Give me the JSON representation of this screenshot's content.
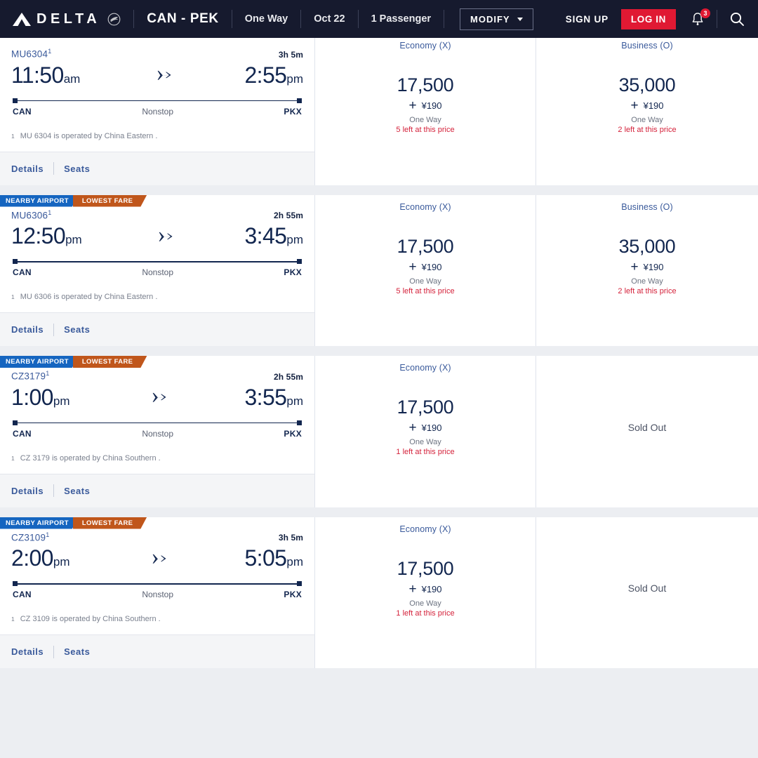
{
  "header": {
    "brand_name": "DELTA",
    "brand_logo_icon": "delta-triangle-icon",
    "skymiles_icon": "skyteam-emblem-icon",
    "route": "CAN - PEK",
    "trip_type": "One Way",
    "date": "Oct 22",
    "passengers": "1 Passenger",
    "modify_label": "MODIFY",
    "sign_up_label": "SIGN UP",
    "log_in_label": "LOG IN",
    "notifications_icon": "bell-icon",
    "notifications_count": "3",
    "search_icon": "search-icon",
    "accent_red": "#e01933",
    "bar_background": "#161a2e"
  },
  "labels": {
    "details": "Details",
    "seats": "Seats",
    "nonstop": "Nonstop",
    "one_way": "One Way",
    "sold_out": "Sold Out",
    "badge_nearby": "NEARBY AIRPORT",
    "badge_lowest": "LOWEST FARE",
    "plus": "+",
    "footnote_marker": "1",
    "plane_icon": "airplane-icon",
    "badge_nearby_color": "#1565c0",
    "badge_lowest_color": "#c0561b"
  },
  "flights": [
    {
      "flight_number": "MU6304",
      "duration": "3h 5m",
      "depart_time": "11:50",
      "depart_meridiem": "am",
      "arrive_time": "2:55",
      "arrive_meridiem": "pm",
      "origin": "CAN",
      "destination": "PKX",
      "stops": "Nonstop",
      "operated_by": "MU 6304 is operated by China Eastern .",
      "has_badges": false,
      "fares": [
        {
          "cabin": "Economy (X)",
          "miles": "17,500",
          "cash": "¥190",
          "one_way": "One Way",
          "seats_left": "5 left at this price",
          "sold_out": false
        },
        {
          "cabin": "Business (O)",
          "miles": "35,000",
          "cash": "¥190",
          "one_way": "One Way",
          "seats_left": "2 left at this price",
          "sold_out": false
        }
      ]
    },
    {
      "flight_number": "MU6306",
      "duration": "2h 55m",
      "depart_time": "12:50",
      "depart_meridiem": "pm",
      "arrive_time": "3:45",
      "arrive_meridiem": "pm",
      "origin": "CAN",
      "destination": "PKX",
      "stops": "Nonstop",
      "operated_by": "MU 6306 is operated by China Eastern .",
      "has_badges": true,
      "fares": [
        {
          "cabin": "Economy (X)",
          "miles": "17,500",
          "cash": "¥190",
          "one_way": "One Way",
          "seats_left": "5 left at this price",
          "sold_out": false
        },
        {
          "cabin": "Business (O)",
          "miles": "35,000",
          "cash": "¥190",
          "one_way": "One Way",
          "seats_left": "2 left at this price",
          "sold_out": false
        }
      ]
    },
    {
      "flight_number": "CZ3179",
      "duration": "2h 55m",
      "depart_time": "1:00",
      "depart_meridiem": "pm",
      "arrive_time": "3:55",
      "arrive_meridiem": "pm",
      "origin": "CAN",
      "destination": "PKX",
      "stops": "Nonstop",
      "operated_by": "CZ 3179 is operated by China Southern .",
      "has_badges": true,
      "fares": [
        {
          "cabin": "Economy (X)",
          "miles": "17,500",
          "cash": "¥190",
          "one_way": "One Way",
          "seats_left": "1 left at this price",
          "sold_out": false
        },
        {
          "cabin": "",
          "sold_out": true,
          "sold_out_label": "Sold Out"
        }
      ]
    },
    {
      "flight_number": "CZ3109",
      "duration": "3h 5m",
      "depart_time": "2:00",
      "depart_meridiem": "pm",
      "arrive_time": "5:05",
      "arrive_meridiem": "pm",
      "origin": "CAN",
      "destination": "PKX",
      "stops": "Nonstop",
      "operated_by": "CZ 3109 is operated by China Southern .",
      "has_badges": true,
      "fares": [
        {
          "cabin": "Economy (X)",
          "miles": "17,500",
          "cash": "¥190",
          "one_way": "One Way",
          "seats_left": "1 left at this price",
          "sold_out": false
        },
        {
          "cabin": "",
          "sold_out": true,
          "sold_out_label": "Sold Out"
        }
      ]
    }
  ]
}
